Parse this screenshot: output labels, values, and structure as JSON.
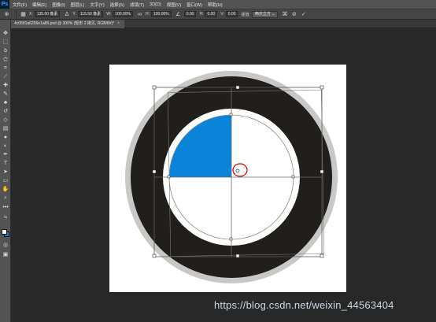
{
  "app": {
    "logo": "Ps"
  },
  "menu": [
    "文件(F)",
    "编辑(E)",
    "图像(I)",
    "图层(L)",
    "文字(Y)",
    "选择(S)",
    "滤镜(T)",
    "3D(D)",
    "视图(V)",
    "窗口(W)",
    "帮助(H)"
  ],
  "options": {
    "x_label": "X:",
    "x_value": "135.00 像素",
    "y_label": "Y:",
    "y_value": "115.50 像素",
    "w_label": "W:",
    "w_value": "100.00%",
    "h_label": "H:",
    "h_value": "100.00%",
    "angle_value": "0.00",
    "hskew_label": "H:",
    "hskew_value": "0.00",
    "vskew_label": "V:",
    "vskew_value": "0.00",
    "interp_label": "插值:",
    "interp_value": "两次立方"
  },
  "document_tab": {
    "title": "4c0581a6256e1a89.psd @ 300% (矩形 2 拷贝, RGB/8#)",
    "modified": "*",
    "close": "×"
  },
  "icons": {
    "tools": [
      "move-icon",
      "marquee-icon",
      "lasso-icon",
      "magic-wand-icon",
      "crop-icon",
      "eyedropper-icon",
      "healing-icon",
      "brush-icon",
      "clone-stamp-icon",
      "history-brush-icon",
      "eraser-icon",
      "gradient-icon",
      "blur-icon",
      "dodge-icon",
      "pen-icon",
      "type-icon",
      "path-select-icon",
      "rectangle-icon",
      "hand-icon",
      "zoom-icon",
      "more-icon"
    ]
  },
  "colors": {
    "foreground": "#ffffff",
    "background": "#0a84d8",
    "quadrant_fill": "#0a84d8",
    "ring_dark": "#211f1b",
    "ring_outer": "#c8c8c8",
    "annotation": "#e00000"
  },
  "watermark": "https://blog.csdn.net/weixin_44563404"
}
